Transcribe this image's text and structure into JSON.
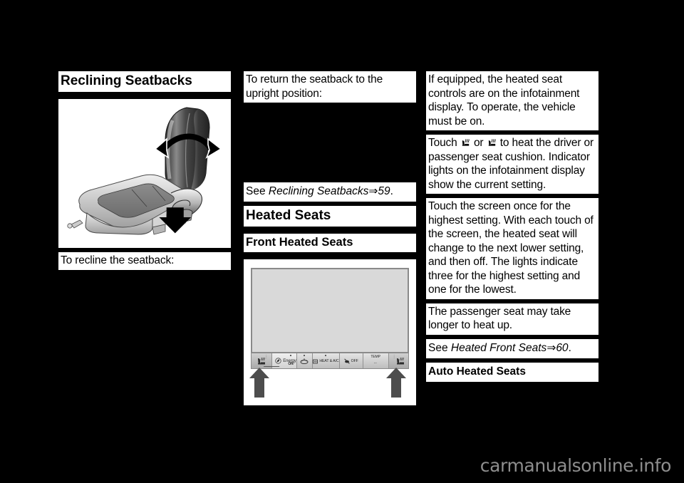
{
  "page": {
    "background_color": "#000000",
    "paper_color": "#ffffff",
    "watermark": "carmanualsonline.info"
  },
  "left_column": {
    "heading": "Reclining Seatbacks",
    "figure": {
      "name": "reclining-seatback-illustration",
      "description": "Car seat shown from the side with a curved double-headed arrow over the seatback and a solid black arrow pointing at the recline lever"
    },
    "caption": "To recline the seatback:"
  },
  "middle_column": {
    "intro": "To return the seatback to the upright position:",
    "xref": {
      "prefix": "See ",
      "title": "Reclining Seatbacks",
      "arrow": "⇒",
      "page": "59",
      "suffix": "."
    },
    "heading": "Heated Seats",
    "subheading": "Front Heated Seats",
    "figure": {
      "name": "infotainment-climate-bar-illustration",
      "description": "Infotainment display with climate control button bar at the bottom; black arrows point up at the driver and passenger heated seat buttons",
      "buttons": [
        {
          "name": "driver-heated-seat-button",
          "label": "",
          "icon": "heated-seat-icon"
        },
        {
          "name": "energy-button",
          "label": "Energy",
          "icon": "energy-leaf-icon",
          "status": "ON"
        },
        {
          "name": "fan-button",
          "label": "",
          "icon": "fan-icon"
        },
        {
          "name": "heat-and-ac-button",
          "label": "HEAT & A/C",
          "icon": "defrost-icon"
        },
        {
          "name": "off-button",
          "label": "OFF",
          "icon": "fan-off-icon"
        },
        {
          "name": "temp-button",
          "label": "TEMP",
          "value": "--"
        },
        {
          "name": "passenger-heated-seat-button",
          "label": "",
          "icon": "heated-seat-icon"
        }
      ]
    }
  },
  "right_column": {
    "paragraphs": [
      "If equipped, the heated seat controls are on the infotainment display. To operate, the vehicle must be on.",
      "Touch the screen once for the highest setting. With each touch of the screen, the heated seat will change to the next lower setting, and then off. The lights indicate three for the highest setting and one for the lowest.",
      "The passenger seat may take longer to heat up."
    ],
    "touch_paragraph": {
      "part1": "Touch ",
      "icon1": "heated-seat-icon",
      "part2": " or ",
      "icon2": "heated-seat-icon",
      "part3": " to heat the driver or passenger seat cushion. Indicator lights on the infotainment display show the current setting."
    },
    "xref": {
      "prefix": "See ",
      "title": "Heated Front Seats",
      "arrow": "⇒",
      "page": "60",
      "suffix": "."
    },
    "subheading": "Auto Heated Seats"
  }
}
